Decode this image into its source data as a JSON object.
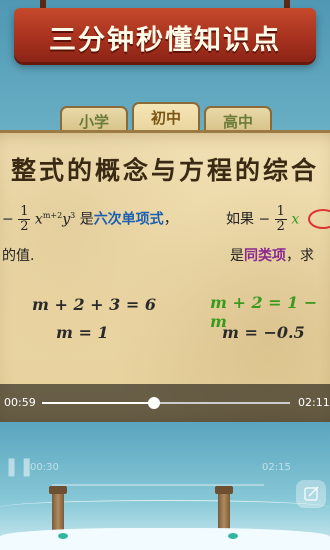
{
  "banner": {
    "title": "三分钟秒懂知识点"
  },
  "tabs": [
    {
      "label": "小学",
      "active": false
    },
    {
      "label": "初中",
      "active": true
    },
    {
      "label": "高中",
      "active": false
    }
  ],
  "board": {
    "title": "整式的概念与方程的综合",
    "line1": {
      "sign": "−",
      "frac_num": "1",
      "frac_den": "2",
      "term": "x",
      "exp1": "m+2",
      "term2": "y",
      "exp2": "3",
      "text_before": "是",
      "highlight": "六次单项式",
      "comma": "，",
      "if_text": "如果",
      "sign2": "−",
      "frac2_num": "1",
      "frac2_den": "2",
      "term3": "x"
    },
    "line2": {
      "left": "的值.",
      "right_prefix": "是",
      "right_highlight": "同类项",
      "right_suffix": "，求"
    },
    "left_eq1": "m + 2 + 3 = 6",
    "left_eq2": "m = 1",
    "right_eq1": "m + 2 = 1 − m",
    "right_eq2": "m = −0.5"
  },
  "video": {
    "current_time": "00:59",
    "total_time": "02:11",
    "progress": 0.45
  },
  "background_player": {
    "current_time": "00:30",
    "total_time": "02:15"
  }
}
